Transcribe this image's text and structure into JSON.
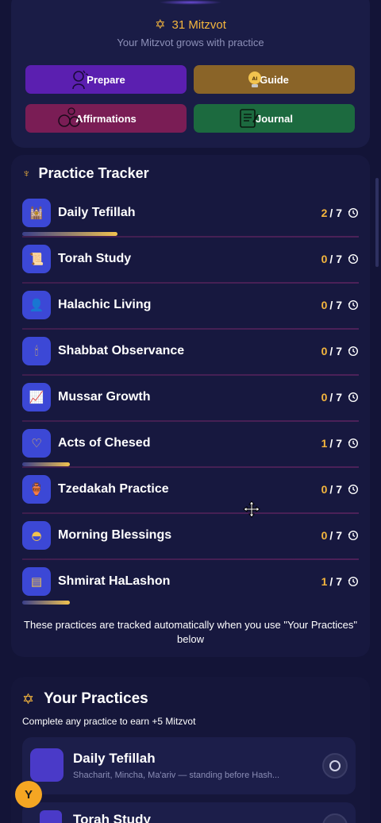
{
  "header": {
    "mitzvot_count": "31 Mitzvot",
    "subtitle": "Your Mitzvot grows with practice",
    "star_icon": "star-of-david-icon"
  },
  "actions": {
    "prepare": "Prepare",
    "guide": "Guide",
    "affirmations": "Affirmations",
    "journal": "Journal"
  },
  "tracker": {
    "title": "Practice Tracker",
    "note": "These practices are tracked automatically when you use \"Your Practices\" below",
    "items": [
      {
        "label": "Daily Tefillah",
        "done": "2",
        "total": "/ 7",
        "progress": 0.286
      },
      {
        "label": "Torah Study",
        "done": "0",
        "total": "/ 7",
        "progress": 0
      },
      {
        "label": "Halachic Living",
        "done": "0",
        "total": "/ 7",
        "progress": 0
      },
      {
        "label": "Shabbat Observance",
        "done": "0",
        "total": "/ 7",
        "progress": 0
      },
      {
        "label": "Mussar Growth",
        "done": "0",
        "total": "/ 7",
        "progress": 0
      },
      {
        "label": "Acts of Chesed",
        "done": "1",
        "total": "/ 7",
        "progress": 0.143
      },
      {
        "label": "Tzedakah Practice",
        "done": "0",
        "total": "/ 7",
        "progress": 0
      },
      {
        "label": "Morning Blessings",
        "done": "0",
        "total": "/ 7",
        "progress": 0
      },
      {
        "label": "Shmirat HaLashon",
        "done": "1",
        "total": "/ 7",
        "progress": 0.143
      }
    ]
  },
  "practices": {
    "title": "Your Practices",
    "subtitle": "Complete any practice to earn +5 Mitzvot",
    "items": [
      {
        "name": "Daily Tefillah",
        "description": "Shacharit, Mincha, Ma'ariv — standing before Hash..."
      },
      {
        "name": "Torah Study",
        "description": ""
      }
    ]
  },
  "user": {
    "avatar_initial": "Y"
  },
  "colors": {
    "background": "#131437",
    "accent_gold": "#f5b63d",
    "prepare": "#5b1fb0",
    "guide": "#8a6428",
    "affirmations": "#7a1d55",
    "journal": "#1c6a3f",
    "icon_tile": "#3c48d6"
  }
}
